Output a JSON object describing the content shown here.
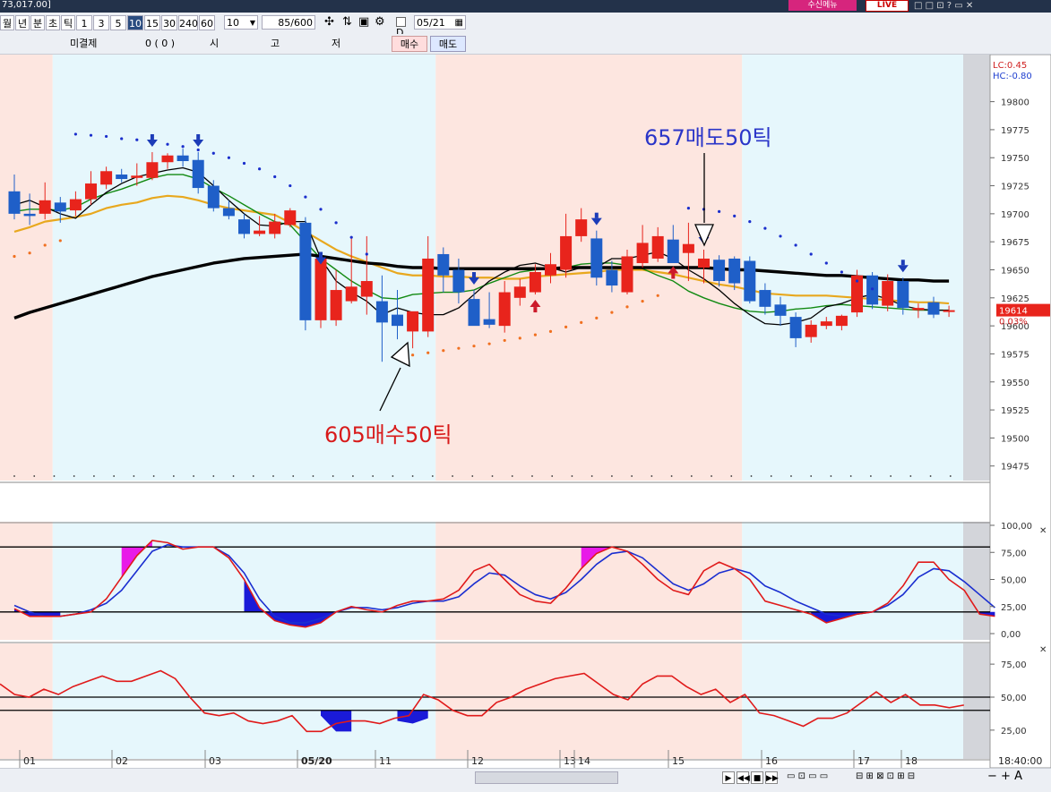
{
  "window": {
    "title": "73,017.00]",
    "badge": "수신메뉴",
    "live": "LIVE",
    "controls": "□ □ ⊡ ? ▭ ✕"
  },
  "toolbar": {
    "periods": [
      "월",
      "년",
      "분",
      "초",
      "틱",
      "1",
      "3",
      "5",
      "10",
      "15",
      "30",
      "240",
      "60"
    ],
    "selected_index": 8,
    "count_value": "10",
    "range_value": "85/600",
    "icons": [
      "crosshair-icon",
      "compare-icon",
      "save-icon",
      "settings-icon"
    ],
    "d_label": "D",
    "date_value": "05/21"
  },
  "order_row": {
    "unfilled_label": "미결제",
    "unfilled_value": "0 (   0   )",
    "open_label": "시",
    "high_label": "고",
    "low_label": "저",
    "buy_label": "매수",
    "sell_label": "매도"
  },
  "annotations": {
    "sell": "657매도50틱",
    "buy": "605매수50틱"
  },
  "price_panel": {
    "lc_label": "LC:0.45",
    "hc_label": "HC:-0.80",
    "current_price": "19614",
    "current_change": "0.03%",
    "y_ticks": [
      19800,
      19775,
      19750,
      19725,
      19700,
      19675,
      19650,
      19625,
      19600,
      19575,
      19550,
      19525,
      19500,
      19475
    ],
    "y_range": [
      19462,
      19838
    ]
  },
  "stoch_panel": {
    "y_ticks": [
      "100,00",
      "75,00",
      "50,00",
      "25,00",
      "0,00"
    ],
    "levels": [
      80,
      20
    ]
  },
  "rsi_panel": {
    "y_ticks": [
      "75,00",
      "50,00",
      "25,00"
    ],
    "levels": [
      50,
      40
    ]
  },
  "x_labels": [
    "01",
    "02",
    "03",
    "05/20",
    "11",
    "12",
    "13",
    "14",
    "15",
    "16",
    "17",
    "18"
  ],
  "time_label": "18:40:00",
  "colors": {
    "up": "#e8241c",
    "down": "#1f5fc8",
    "ma5": "#000000",
    "ma10": "#128a12",
    "ma20": "#e8a81e",
    "ma60": "#000000",
    "session_a": "#fde6e0",
    "session_b": "#e6f7fc"
  },
  "chart_data": {
    "type": "candlestick",
    "candles": [
      {
        "o": 19720,
        "h": 19735,
        "l": 19695,
        "c": 19700
      },
      {
        "o": 19700,
        "h": 19718,
        "l": 19690,
        "c": 19698
      },
      {
        "o": 19700,
        "h": 19728,
        "l": 19695,
        "c": 19712
      },
      {
        "o": 19710,
        "h": 19715,
        "l": 19692,
        "c": 19702
      },
      {
        "o": 19703,
        "h": 19720,
        "l": 19698,
        "c": 19713
      },
      {
        "o": 19713,
        "h": 19738,
        "l": 19708,
        "c": 19727
      },
      {
        "o": 19726,
        "h": 19742,
        "l": 19722,
        "c": 19738
      },
      {
        "o": 19735,
        "h": 19740,
        "l": 19728,
        "c": 19731
      },
      {
        "o": 19732,
        "h": 19745,
        "l": 19725,
        "c": 19734
      },
      {
        "o": 19732,
        "h": 19755,
        "l": 19730,
        "c": 19746
      },
      {
        "o": 19746,
        "h": 19754,
        "l": 19740,
        "c": 19752
      },
      {
        "o": 19752,
        "h": 19758,
        "l": 19742,
        "c": 19747
      },
      {
        "o": 19748,
        "h": 19755,
        "l": 19718,
        "c": 19723
      },
      {
        "o": 19725,
        "h": 19730,
        "l": 19702,
        "c": 19705
      },
      {
        "o": 19705,
        "h": 19712,
        "l": 19695,
        "c": 19698
      },
      {
        "o": 19695,
        "h": 19700,
        "l": 19678,
        "c": 19682
      },
      {
        "o": 19682,
        "h": 19698,
        "l": 19680,
        "c": 19685
      },
      {
        "o": 19682,
        "h": 19700,
        "l": 19678,
        "c": 19693
      },
      {
        "o": 19690,
        "h": 19705,
        "l": 19688,
        "c": 19703
      },
      {
        "o": 19692,
        "h": 19697,
        "l": 19596,
        "c": 19605
      },
      {
        "o": 19605,
        "h": 19650,
        "l": 19598,
        "c": 19660
      },
      {
        "o": 19605,
        "h": 19650,
        "l": 19600,
        "c": 19632
      },
      {
        "o": 19622,
        "h": 19680,
        "l": 19620,
        "c": 19635
      },
      {
        "o": 19626,
        "h": 19680,
        "l": 19610,
        "c": 19640
      },
      {
        "o": 19622,
        "h": 19645,
        "l": 19568,
        "c": 19603
      },
      {
        "o": 19610,
        "h": 19632,
        "l": 19588,
        "c": 19600
      },
      {
        "o": 19595,
        "h": 19612,
        "l": 19580,
        "c": 19613
      },
      {
        "o": 19595,
        "h": 19680,
        "l": 19590,
        "c": 19660
      },
      {
        "o": 19664,
        "h": 19670,
        "l": 19630,
        "c": 19645
      },
      {
        "o": 19650,
        "h": 19660,
        "l": 19620,
        "c": 19630
      },
      {
        "o": 19624,
        "h": 19632,
        "l": 19603,
        "c": 19600
      },
      {
        "o": 19606,
        "h": 19630,
        "l": 19598,
        "c": 19601
      },
      {
        "o": 19600,
        "h": 19640,
        "l": 19594,
        "c": 19630
      },
      {
        "o": 19625,
        "h": 19642,
        "l": 19618,
        "c": 19635
      },
      {
        "o": 19630,
        "h": 19655,
        "l": 19628,
        "c": 19648
      },
      {
        "o": 19645,
        "h": 19665,
        "l": 19638,
        "c": 19655
      },
      {
        "o": 19650,
        "h": 19700,
        "l": 19643,
        "c": 19680
      },
      {
        "o": 19680,
        "h": 19705,
        "l": 19675,
        "c": 19695
      },
      {
        "o": 19678,
        "h": 19685,
        "l": 19636,
        "c": 19643
      },
      {
        "o": 19650,
        "h": 19658,
        "l": 19630,
        "c": 19636
      },
      {
        "o": 19630,
        "h": 19668,
        "l": 19628,
        "c": 19662
      },
      {
        "o": 19656,
        "h": 19690,
        "l": 19652,
        "c": 19674
      },
      {
        "o": 19660,
        "h": 19688,
        "l": 19657,
        "c": 19680
      },
      {
        "o": 19677,
        "h": 19690,
        "l": 19658,
        "c": 19656
      },
      {
        "o": 19665,
        "h": 19692,
        "l": 19640,
        "c": 19673
      },
      {
        "o": 19652,
        "h": 19668,
        "l": 19638,
        "c": 19660
      },
      {
        "o": 19659,
        "h": 19663,
        "l": 19635,
        "c": 19640
      },
      {
        "o": 19660,
        "h": 19662,
        "l": 19632,
        "c": 19638
      },
      {
        "o": 19658,
        "h": 19662,
        "l": 19620,
        "c": 19622
      },
      {
        "o": 19632,
        "h": 19638,
        "l": 19610,
        "c": 19617
      },
      {
        "o": 19619,
        "h": 19626,
        "l": 19600,
        "c": 19609
      },
      {
        "o": 19608,
        "h": 19612,
        "l": 19581,
        "c": 19589
      },
      {
        "o": 19590,
        "h": 19605,
        "l": 19585,
        "c": 19601
      },
      {
        "o": 19600,
        "h": 19608,
        "l": 19597,
        "c": 19604
      },
      {
        "o": 19600,
        "h": 19610,
        "l": 19596,
        "c": 19609
      },
      {
        "o": 19612,
        "h": 19650,
        "l": 19608,
        "c": 19645
      },
      {
        "o": 19645,
        "h": 19648,
        "l": 19615,
        "c": 19619
      },
      {
        "o": 19618,
        "h": 19646,
        "l": 19613,
        "c": 19640
      },
      {
        "o": 19640,
        "h": 19643,
        "l": 19610,
        "c": 19616
      },
      {
        "o": 19614,
        "h": 19620,
        "l": 19607,
        "c": 19616
      },
      {
        "o": 19621,
        "h": 19626,
        "l": 19607,
        "c": 19610
      },
      {
        "o": 19614,
        "h": 19618,
        "l": 19608,
        "c": 19614
      }
    ],
    "overlays": {
      "ma5": [
        19708,
        19712,
        19706,
        19700,
        19696,
        19708,
        19719,
        19727,
        19733,
        19736,
        19739,
        19741,
        19737,
        19725,
        19712,
        19700,
        19690,
        19689,
        19693,
        19693,
        19660,
        19640,
        19630,
        19622,
        19610,
        19616,
        19612,
        19610,
        19610,
        19616,
        19628,
        19640,
        19648,
        19654,
        19656,
        19652,
        19648,
        19652,
        19652,
        19660,
        19660,
        19663,
        19666,
        19660,
        19650,
        19642,
        19632,
        19620,
        19610,
        19602,
        19601,
        19603,
        19607,
        19617,
        19620,
        19625,
        19628,
        19624,
        19618,
        19615,
        19614,
        19614
      ],
      "ma10": [
        19702,
        19704,
        19704,
        19703,
        19706,
        19713,
        19718,
        19722,
        19727,
        19732,
        19735,
        19735,
        19731,
        19723,
        19716,
        19708,
        19700,
        19693,
        19690,
        19675,
        19660,
        19650,
        19640,
        19632,
        19625,
        19624,
        19628,
        19629,
        19630,
        19630,
        19632,
        19638,
        19643,
        19648,
        19650,
        19651,
        19652,
        19655,
        19656,
        19656,
        19654,
        19651,
        19645,
        19640,
        19631,
        19625,
        19620,
        19616,
        19613,
        19612,
        19613,
        19615,
        19616,
        19618,
        19619,
        19618,
        19617,
        19616,
        19615,
        19614,
        19614,
        19614
      ],
      "ma20": [
        19684,
        19688,
        19693,
        19695,
        19697,
        19700,
        19705,
        19708,
        19710,
        19714,
        19716,
        19715,
        19712,
        19708,
        19705,
        19703,
        19701,
        19699,
        19692,
        19684,
        19676,
        19668,
        19662,
        19657,
        19652,
        19647,
        19645,
        19645,
        19644,
        19644,
        19643,
        19643,
        19642,
        19642,
        19644,
        19645,
        19646,
        19647,
        19648,
        19650,
        19650,
        19650,
        19648,
        19646,
        19643,
        19640,
        19637,
        19635,
        19632,
        19629,
        19628,
        19627,
        19627,
        19627,
        19626,
        19625,
        19624,
        19623,
        19622,
        19621,
        19621,
        19620
      ],
      "ma60": [
        19607,
        19612,
        19616,
        19620,
        19624,
        19628,
        19632,
        19636,
        19640,
        19644,
        19647,
        19650,
        19653,
        19656,
        19658,
        19660,
        19661,
        19662,
        19663,
        19664,
        19662,
        19660,
        19658,
        19656,
        19655,
        19653,
        19652,
        19652,
        19651,
        19651,
        19651,
        19651,
        19651,
        19651,
        19651,
        19651,
        19652,
        19652,
        19652,
        19652,
        19652,
        19652,
        19652,
        19652,
        19652,
        19652,
        19651,
        19650,
        19650,
        19649,
        19648,
        19647,
        19646,
        19645,
        19645,
        19644,
        19643,
        19642,
        19641,
        19641,
        19640,
        19640
      ]
    },
    "parabolic_sar": [
      {
        "x": 0,
        "y": 19662
      },
      {
        "x": 1,
        "y": 19665
      },
      {
        "x": 2,
        "y": 19672
      },
      {
        "x": 3,
        "y": 19676
      },
      {
        "x": 4,
        "y": 19771
      },
      {
        "x": 5,
        "y": 19770
      },
      {
        "x": 6,
        "y": 19769
      },
      {
        "x": 7,
        "y": 19767
      },
      {
        "x": 8,
        "y": 19766
      },
      {
        "x": 9,
        "y": 19764
      },
      {
        "x": 10,
        "y": 19762
      },
      {
        "x": 11,
        "y": 19760
      },
      {
        "x": 12,
        "y": 19757
      },
      {
        "x": 13,
        "y": 19754
      },
      {
        "x": 14,
        "y": 19750
      },
      {
        "x": 15,
        "y": 19745
      },
      {
        "x": 16,
        "y": 19740
      },
      {
        "x": 17,
        "y": 19733
      },
      {
        "x": 18,
        "y": 19725
      },
      {
        "x": 19,
        "y": 19715
      },
      {
        "x": 20,
        "y": 19704
      },
      {
        "x": 21,
        "y": 19692
      },
      {
        "x": 22,
        "y": 19679
      },
      {
        "x": 23,
        "y": 19664
      },
      {
        "x": 25,
        "y": 19572
      },
      {
        "x": 26,
        "y": 19574
      },
      {
        "x": 27,
        "y": 19576
      },
      {
        "x": 28,
        "y": 19578
      },
      {
        "x": 29,
        "y": 19580
      },
      {
        "x": 30,
        "y": 19582
      },
      {
        "x": 31,
        "y": 19584
      },
      {
        "x": 32,
        "y": 19587
      },
      {
        "x": 33,
        "y": 19589
      },
      {
        "x": 34,
        "y": 19592
      },
      {
        "x": 35,
        "y": 19595
      },
      {
        "x": 36,
        "y": 19599
      },
      {
        "x": 37,
        "y": 19603
      },
      {
        "x": 38,
        "y": 19607
      },
      {
        "x": 39,
        "y": 19612
      },
      {
        "x": 40,
        "y": 19617
      },
      {
        "x": 41,
        "y": 19622
      },
      {
        "x": 42,
        "y": 19627
      },
      {
        "x": 44,
        "y": 19705
      },
      {
        "x": 45,
        "y": 19704
      },
      {
        "x": 46,
        "y": 19702
      },
      {
        "x": 47,
        "y": 19698
      },
      {
        "x": 48,
        "y": 19693
      },
      {
        "x": 49,
        "y": 19687
      },
      {
        "x": 50,
        "y": 19680
      },
      {
        "x": 51,
        "y": 19672
      },
      {
        "x": 52,
        "y": 19664
      },
      {
        "x": 53,
        "y": 19656
      },
      {
        "x": 54,
        "y": 19648
      },
      {
        "x": 55,
        "y": 19640
      },
      {
        "x": 56,
        "y": 19633
      }
    ],
    "signals": [
      {
        "x": 9,
        "type": "sell"
      },
      {
        "x": 12,
        "type": "sell"
      },
      {
        "x": 20,
        "type": "sell"
      },
      {
        "x": 30,
        "type": "sell"
      },
      {
        "x": 38,
        "type": "sell"
      },
      {
        "x": 45,
        "type": "sell"
      },
      {
        "x": 58,
        "type": "sell"
      },
      {
        "x": 34,
        "type": "buy"
      },
      {
        "x": 43,
        "type": "buy"
      }
    ],
    "stochastic": {
      "ylim": [
        0,
        100
      ],
      "fast": [
        23,
        16,
        16,
        16,
        18,
        20,
        32,
        52,
        72,
        86,
        84,
        78,
        80,
        80,
        70,
        50,
        24,
        12,
        8,
        6,
        10,
        20,
        25,
        22,
        20,
        26,
        30,
        30,
        32,
        40,
        58,
        64,
        50,
        36,
        30,
        28,
        42,
        60,
        74,
        80,
        76,
        64,
        50,
        40,
        36,
        58,
        66,
        60,
        50,
        30,
        26,
        22,
        18,
        10,
        14,
        18,
        20,
        28,
        44,
        66,
        66,
        50,
        40,
        18,
        16
      ],
      "slow": [
        26,
        20,
        16,
        16,
        18,
        22,
        28,
        40,
        58,
        76,
        82,
        80,
        80,
        80,
        72,
        56,
        32,
        16,
        10,
        10,
        14,
        20,
        24,
        24,
        22,
        24,
        28,
        30,
        30,
        34,
        46,
        56,
        54,
        44,
        36,
        32,
        38,
        50,
        64,
        74,
        76,
        70,
        58,
        46,
        40,
        46,
        56,
        60,
        56,
        44,
        38,
        30,
        24,
        18,
        16,
        18,
        20,
        26,
        36,
        52,
        60,
        58,
        48,
        36,
        24
      ],
      "shading": [
        {
          "from": 0,
          "to": 3,
          "color": "blue"
        },
        {
          "from": 7,
          "to": 9,
          "color": "magenta"
        },
        {
          "from": 15,
          "to": 21,
          "color": "blue"
        },
        {
          "from": 37,
          "to": 39,
          "color": "magenta"
        },
        {
          "from": 52,
          "to": 56,
          "color": "blue"
        },
        {
          "from": 63,
          "to": 64,
          "color": "blue"
        }
      ]
    },
    "rsi": {
      "ylim": [
        10,
        90
      ],
      "values": [
        60,
        52,
        50,
        56,
        52,
        58,
        62,
        66,
        62,
        62,
        66,
        70,
        64,
        50,
        38,
        36,
        38,
        32,
        30,
        32,
        36,
        24,
        24,
        30,
        32,
        32,
        30,
        34,
        36,
        52,
        48,
        40,
        36,
        36,
        46,
        50,
        56,
        60,
        64,
        66,
        68,
        60,
        52,
        48,
        60,
        66,
        66,
        58,
        52,
        56,
        46,
        52,
        38,
        36,
        32,
        28,
        34,
        34,
        38,
        46,
        54,
        46,
        52,
        44,
        44,
        42,
        44
      ],
      "levels": [
        50,
        40
      ]
    }
  }
}
